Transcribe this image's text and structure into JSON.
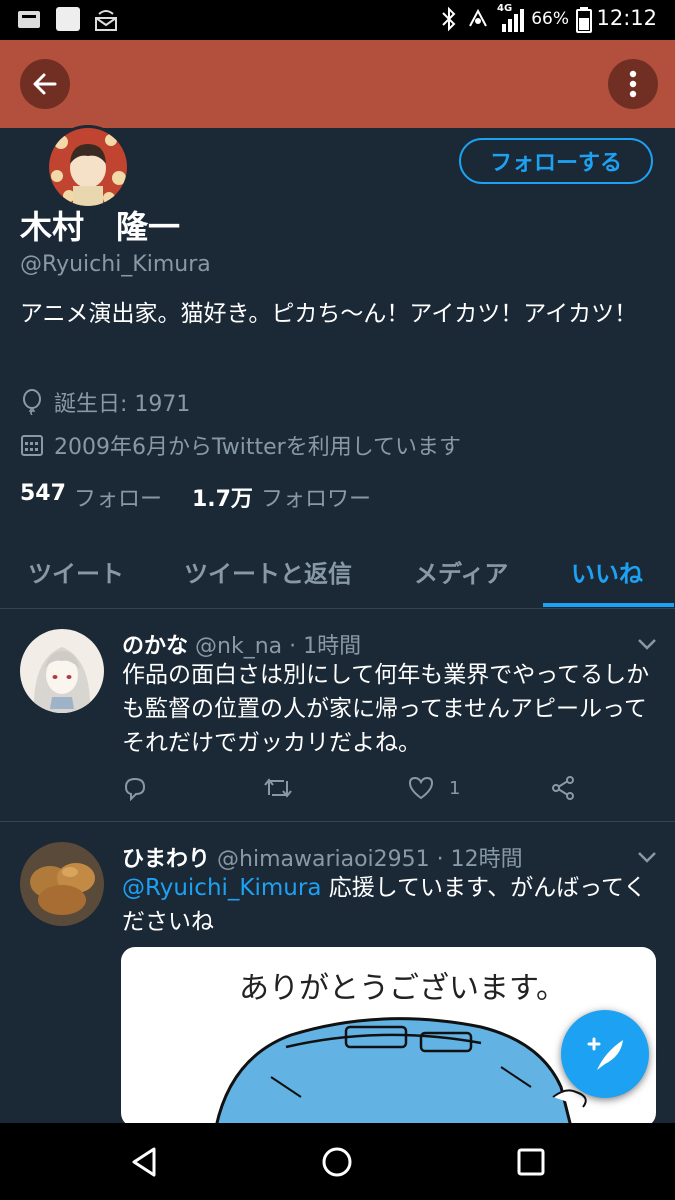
{
  "status_bar": {
    "network": "4G",
    "battery": "66%",
    "time": "12:12"
  },
  "profile": {
    "name": "木村　隆一",
    "handle": "@Ryuichi_Kimura",
    "follow_label": "フォローする",
    "bio": "アニメ演出家。猫好き。ピカち〜ん！アイカツ！アイカツ！",
    "birthday": "誕生日: 1971",
    "joined": "2009年6月からTwitterを利用しています",
    "following_count": "547",
    "following_label": "フォロー",
    "followers_count": "1.7万",
    "followers_label": "フォロワー"
  },
  "tabs": [
    {
      "label": "ツイート",
      "active": false
    },
    {
      "label": "ツイートと返信",
      "active": false
    },
    {
      "label": "メディア",
      "active": false
    },
    {
      "label": "いいね",
      "active": true
    }
  ],
  "tweets": [
    {
      "name": "のかな",
      "handle": "@nk_na",
      "time": "· 1時間",
      "text": "作品の面白さは別にして何年も業界でやってるしかも監督の位置の人が家に帰ってませんアピールってそれだけでガッカリだよね。",
      "like_count": "1"
    },
    {
      "name": "ひまわり",
      "handle": "@himawariaoi2951",
      "time": "· 12時間",
      "mention": "@Ryuichi_Kimura",
      "text": " 応援しています、がんばってくださいね",
      "media_caption": "ありがとうございます。"
    }
  ],
  "colors": {
    "background": "#1b2836",
    "header": "#b2503d",
    "accent": "#1da1f2",
    "muted": "#8899a6"
  }
}
